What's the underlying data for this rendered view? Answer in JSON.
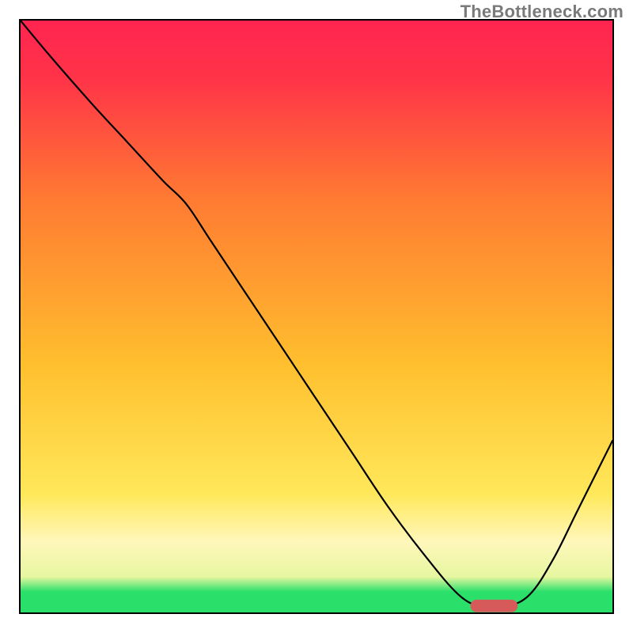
{
  "watermark": "TheBottleneck.com",
  "chart_data": {
    "type": "line",
    "title": "",
    "xlabel": "",
    "ylabel": "",
    "xlim": [
      0,
      100
    ],
    "ylim": [
      0,
      100
    ],
    "background_gradient": {
      "stops": [
        {
          "pos": 0.0,
          "color": "#2be06a"
        },
        {
          "pos": 0.035,
          "color": "#2be06a"
        },
        {
          "pos": 0.06,
          "color": "#e6f7a0"
        },
        {
          "pos": 0.12,
          "color": "#fff7bb"
        },
        {
          "pos": 0.2,
          "color": "#ffe85a"
        },
        {
          "pos": 0.42,
          "color": "#ffbf2e"
        },
        {
          "pos": 0.7,
          "color": "#ff7a32"
        },
        {
          "pos": 0.9,
          "color": "#ff3448"
        },
        {
          "pos": 1.0,
          "color": "#ff2450"
        }
      ]
    },
    "series": [
      {
        "name": "bottleneck-curve",
        "color": "#000000",
        "width": 2.2,
        "x": [
          0,
          5,
          12,
          18,
          24,
          28,
          32,
          38,
          44,
          50,
          56,
          62,
          68,
          74,
          78,
          82,
          86,
          90,
          94,
          98,
          100
        ],
        "y": [
          100,
          94,
          86,
          79.5,
          73,
          69,
          63,
          54,
          45,
          36,
          27,
          18,
          10,
          3,
          1,
          1,
          3,
          9,
          17,
          25,
          29
        ]
      }
    ],
    "markers": [
      {
        "name": "optimal-zone",
        "type": "rounded-bar",
        "color": "#d65a5a",
        "x_range": [
          76,
          84
        ],
        "y": 1.1,
        "height": 2.1
      }
    ]
  }
}
